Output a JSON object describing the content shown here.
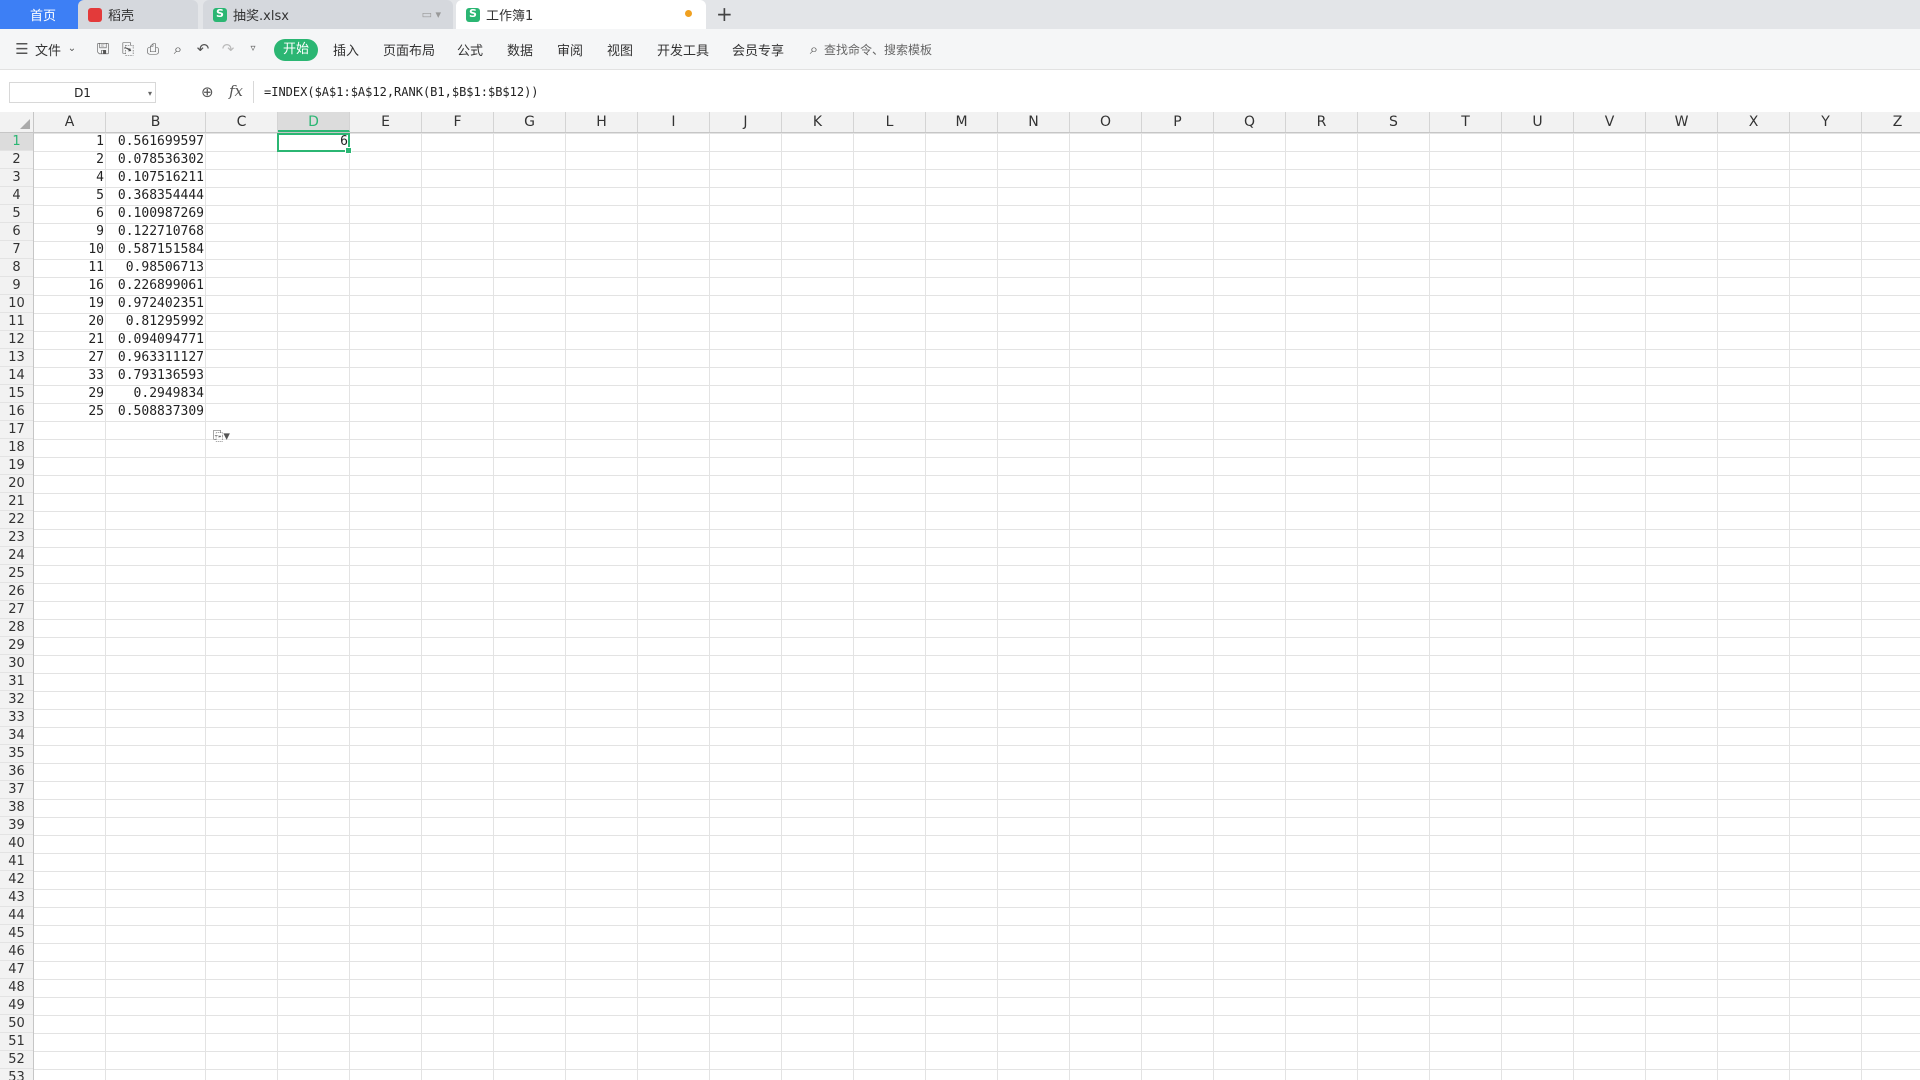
{
  "tabs": {
    "home": "首页",
    "daoke": "稻壳",
    "file1": "抽奖.xlsx",
    "file2": "工作簿1",
    "new_tab": "+"
  },
  "toolbar": {
    "file_menu": "文件",
    "start": "开始",
    "insert": "插入",
    "page_layout": "页面布局",
    "formula": "公式",
    "data": "数据",
    "review": "审阅",
    "view": "视图",
    "dev_tools": "开发工具",
    "member": "会员专享",
    "search_placeholder": "查找命令、搜索模板"
  },
  "formula_bar": {
    "name_box": "D1",
    "fx": "fx",
    "formula": "=INDEX($A$1:$A$12,RANK(B1,$B$1:$B$12))"
  },
  "columns": [
    "A",
    "B",
    "C",
    "D",
    "E",
    "F",
    "G",
    "H",
    "I",
    "J",
    "K",
    "L",
    "M",
    "N",
    "O",
    "P",
    "Q",
    "R",
    "S",
    "T",
    "U",
    "V",
    "W",
    "X",
    "Y",
    "Z"
  ],
  "rows": [
    "1",
    "2",
    "3",
    "4",
    "5",
    "6",
    "7",
    "8",
    "9",
    "10",
    "11",
    "12",
    "13",
    "14",
    "15",
    "16",
    "17",
    "18",
    "19",
    "20",
    "21",
    "22",
    "23",
    "24",
    "25",
    "26",
    "27",
    "28",
    "29",
    "30",
    "31",
    "32",
    "33",
    "34",
    "35",
    "36",
    "37",
    "38",
    "39",
    "40",
    "41",
    "42",
    "43",
    "44",
    "45",
    "46",
    "47",
    "48",
    "49",
    "50",
    "51",
    "52",
    "53"
  ],
  "selected_cell": {
    "col": "D",
    "row": "1",
    "value": "6"
  },
  "col_a": [
    "1",
    "2",
    "4",
    "5",
    "6",
    "9",
    "10",
    "11",
    "16",
    "19",
    "20",
    "21",
    "27",
    "33",
    "29",
    "25"
  ],
  "col_b": [
    "0.561699597",
    "0.078536302",
    "0.107516211",
    "0.368354444",
    "0.100987269",
    "0.122710768",
    "0.587151584",
    "0.98506713",
    "0.226899061",
    "0.972402351",
    "0.81295992",
    "0.094094771",
    "0.963311127",
    "0.793136593",
    "0.2949834",
    "0.508837309"
  ],
  "colors": {
    "accent": "#2bb673",
    "home_tab": "#3d7ff5"
  }
}
